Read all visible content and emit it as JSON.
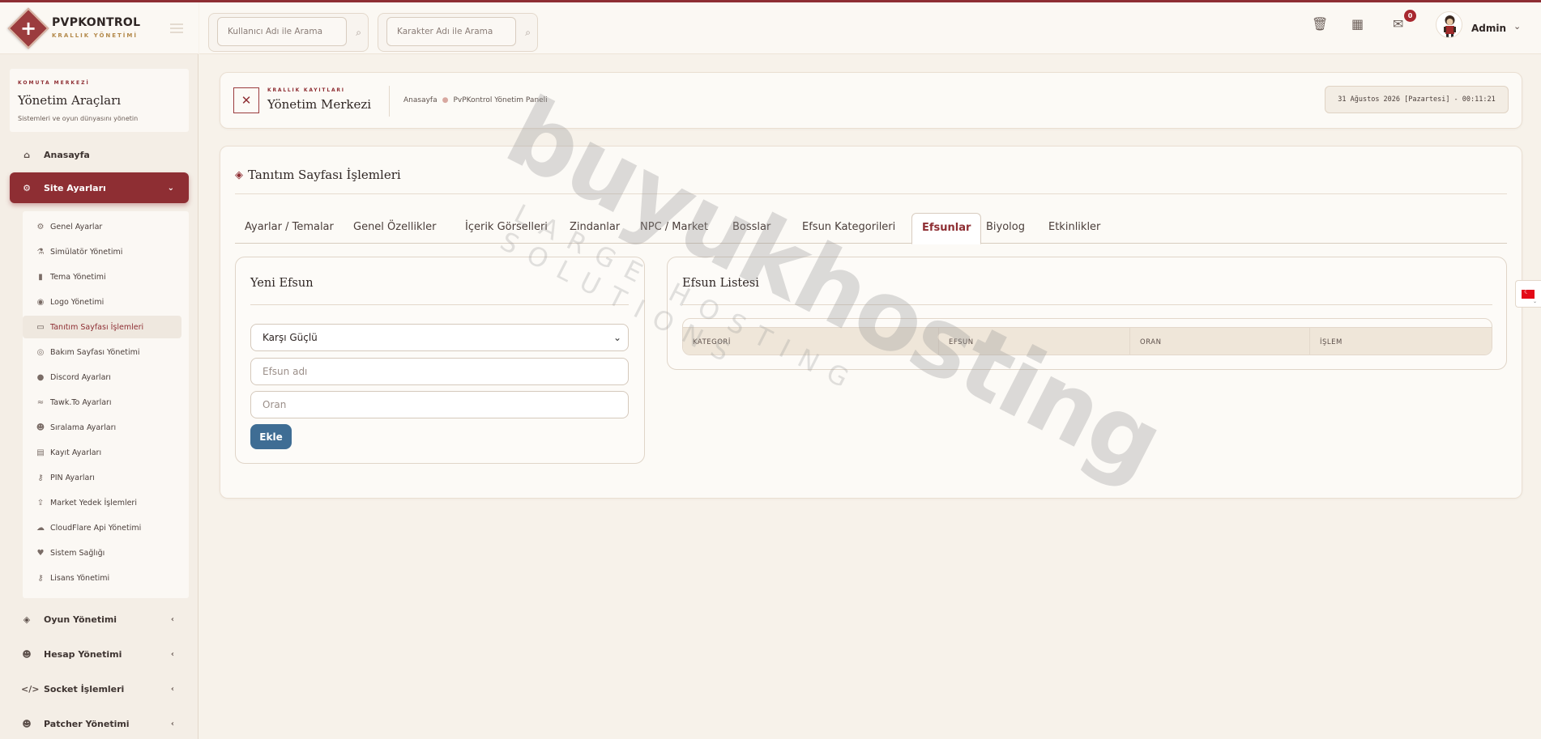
{
  "brand": {
    "title": "PVPKONTROL",
    "subtitle": "KRALLIK YÖNETİMİ"
  },
  "command": {
    "kicker": "KOMUTA MERKEZİ",
    "title": "Yönetim Araçları",
    "subtitle": "Sistemleri ve oyun dünyasını yönetin"
  },
  "sidebar": {
    "top_items": [
      {
        "label": "Anasayfa",
        "icon": "home-icon"
      },
      {
        "label": "Site Ayarları",
        "icon": "gear-icon",
        "active": true
      }
    ],
    "sub_items": [
      {
        "label": "Genel Ayarlar",
        "icon": "gears-icon"
      },
      {
        "label": "Simülatör Yönetimi",
        "icon": "flask-icon"
      },
      {
        "label": "Tema Yönetimi",
        "icon": "file-icon"
      },
      {
        "label": "Logo Yönetimi",
        "icon": "eye-icon"
      },
      {
        "label": "Tanıtım Sayfası İşlemleri",
        "icon": "monitor-icon",
        "active": true
      },
      {
        "label": "Bakım Sayfası Yönetimi",
        "icon": "eye-slash-icon"
      },
      {
        "label": "Discord Ayarları",
        "icon": "microphone-icon"
      },
      {
        "label": "Tawk.To Ayarları",
        "icon": "handshake-icon"
      },
      {
        "label": "Sıralama Ayarları",
        "icon": "users-icon"
      },
      {
        "label": "Kayıt Ayarları",
        "icon": "id-card-icon"
      },
      {
        "label": "PIN Ayarları",
        "icon": "key-icon"
      },
      {
        "label": "Market Yedek İşlemleri",
        "icon": "upload-icon"
      },
      {
        "label": "CloudFlare Api Yönetimi",
        "icon": "cloud-icon"
      },
      {
        "label": "Sistem Sağlığı",
        "icon": "heartbeat-icon"
      },
      {
        "label": "Lisans Yönetimi",
        "icon": "key-icon"
      }
    ],
    "bottom_items": [
      {
        "label": "Oyun Yönetimi",
        "icon": "gamepad-icon"
      },
      {
        "label": "Hesap Yönetimi",
        "icon": "users-icon"
      },
      {
        "label": "Socket İşlemleri",
        "icon": "code-icon"
      },
      {
        "label": "Patcher Yönetimi",
        "icon": "users-icon"
      }
    ]
  },
  "header": {
    "search_user_placeholder": "Kullanıcı Adı ile Arama",
    "search_char_placeholder": "Karakter Adı ile Arama",
    "notification_count": "0",
    "username": "Admin"
  },
  "breadcrumb": {
    "kicker": "KRALLIK KAYITLARI",
    "title": "Yönetim Merkezi",
    "home": "Anasayfa",
    "current": "PvPKontrol Yönetim Paneli",
    "datetime": "31 Ağustos 2026 [Pazartesi] - 00:11:21"
  },
  "main": {
    "title": "Tanıtım Sayfası İşlemleri",
    "tabs": [
      "Ayarlar / Temalar",
      "Genel Özellikler",
      "İçerik Görselleri",
      "Zindanlar",
      "NPC / Market",
      "Bosslar",
      "Efsun Kategorileri",
      "Efsunlar",
      "Biyolog",
      "Etkinlikler"
    ],
    "active_tab": "Efsunlar"
  },
  "form": {
    "title": "Yeni Efsun",
    "category_value": "Karşı Güçlü",
    "name_placeholder": "Efsun adı",
    "rate_placeholder": "Oran",
    "submit_label": "Ekle"
  },
  "list": {
    "title": "Efsun Listesi",
    "columns": [
      "KATEGORİ",
      "EFSUN",
      "ORAN",
      "İŞLEM"
    ],
    "rows": []
  },
  "watermark": {
    "main": "buyukhosting",
    "sub": "LARGE HOSTING SOLUTIONS"
  },
  "colors": {
    "accent": "#8e2e33",
    "button": "#3f6d94",
    "background": "#f7f2ea"
  }
}
